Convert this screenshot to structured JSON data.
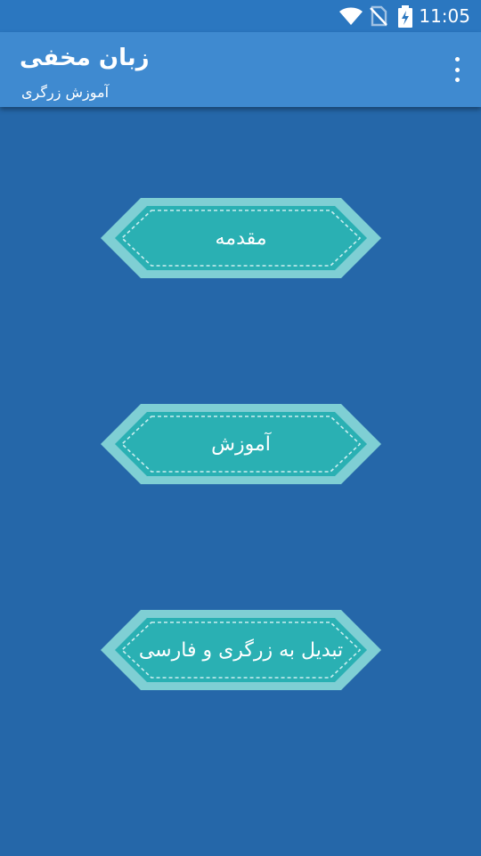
{
  "status_bar": {
    "time": "11:05",
    "icons": [
      "wifi-icon",
      "no-sim-icon",
      "battery-charging-icon"
    ]
  },
  "app_bar": {
    "title": "زبان مخفی",
    "subtitle": "آموزش زرگری",
    "overflow_icon": "more-vertical-icon"
  },
  "menu": {
    "items": [
      {
        "label": "مقدمه"
      },
      {
        "label": "آموزش"
      },
      {
        "label": "تبدیل به زرگری  و فارسی"
      }
    ]
  },
  "colors": {
    "background": "#2567a9",
    "status_bar": "#2b77c0",
    "app_bar": "#3f8ad0",
    "button_outer": "#7fcfd4",
    "button_inner": "#2ab0b3",
    "button_stitch": "#c9eef0"
  }
}
